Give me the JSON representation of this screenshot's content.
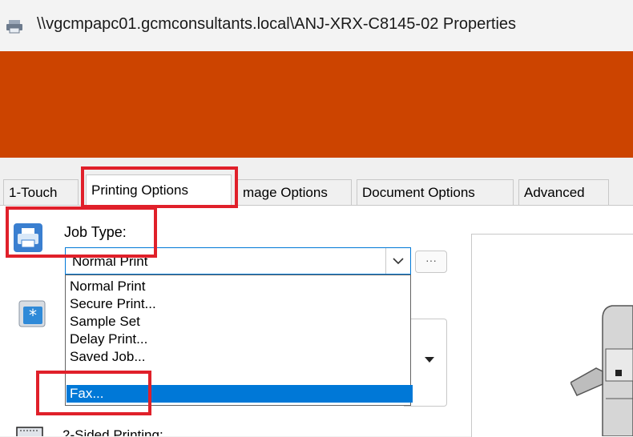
{
  "window": {
    "title": "\\\\vgcmpapc01.gcmconsultants.local\\ANJ-XRX-C8145-02 Properties",
    "title_icon": "printer-icon"
  },
  "banner": {
    "color": "#cc4400"
  },
  "tabs": [
    {
      "label": "1-Touch"
    },
    {
      "label": "Printing Options"
    },
    {
      "label": "mage Options"
    },
    {
      "label": "Document Options"
    },
    {
      "label": "Advanced"
    }
  ],
  "job_type": {
    "label": "Job Type:",
    "selected": "Normal Print",
    "more_label": "···",
    "options": [
      {
        "label": "Normal Print"
      },
      {
        "label": "Secure Print..."
      },
      {
        "label": "Sample Set"
      },
      {
        "label": "Delay Print..."
      },
      {
        "label": "Saved Job..."
      },
      {
        "label": "Fax..."
      }
    ],
    "highlighted_option": "Fax..."
  },
  "two_sided": {
    "label": "2-Sided Printing:"
  },
  "colors": {
    "accent": "#0078d7",
    "highlight_box": "#e0202a"
  }
}
